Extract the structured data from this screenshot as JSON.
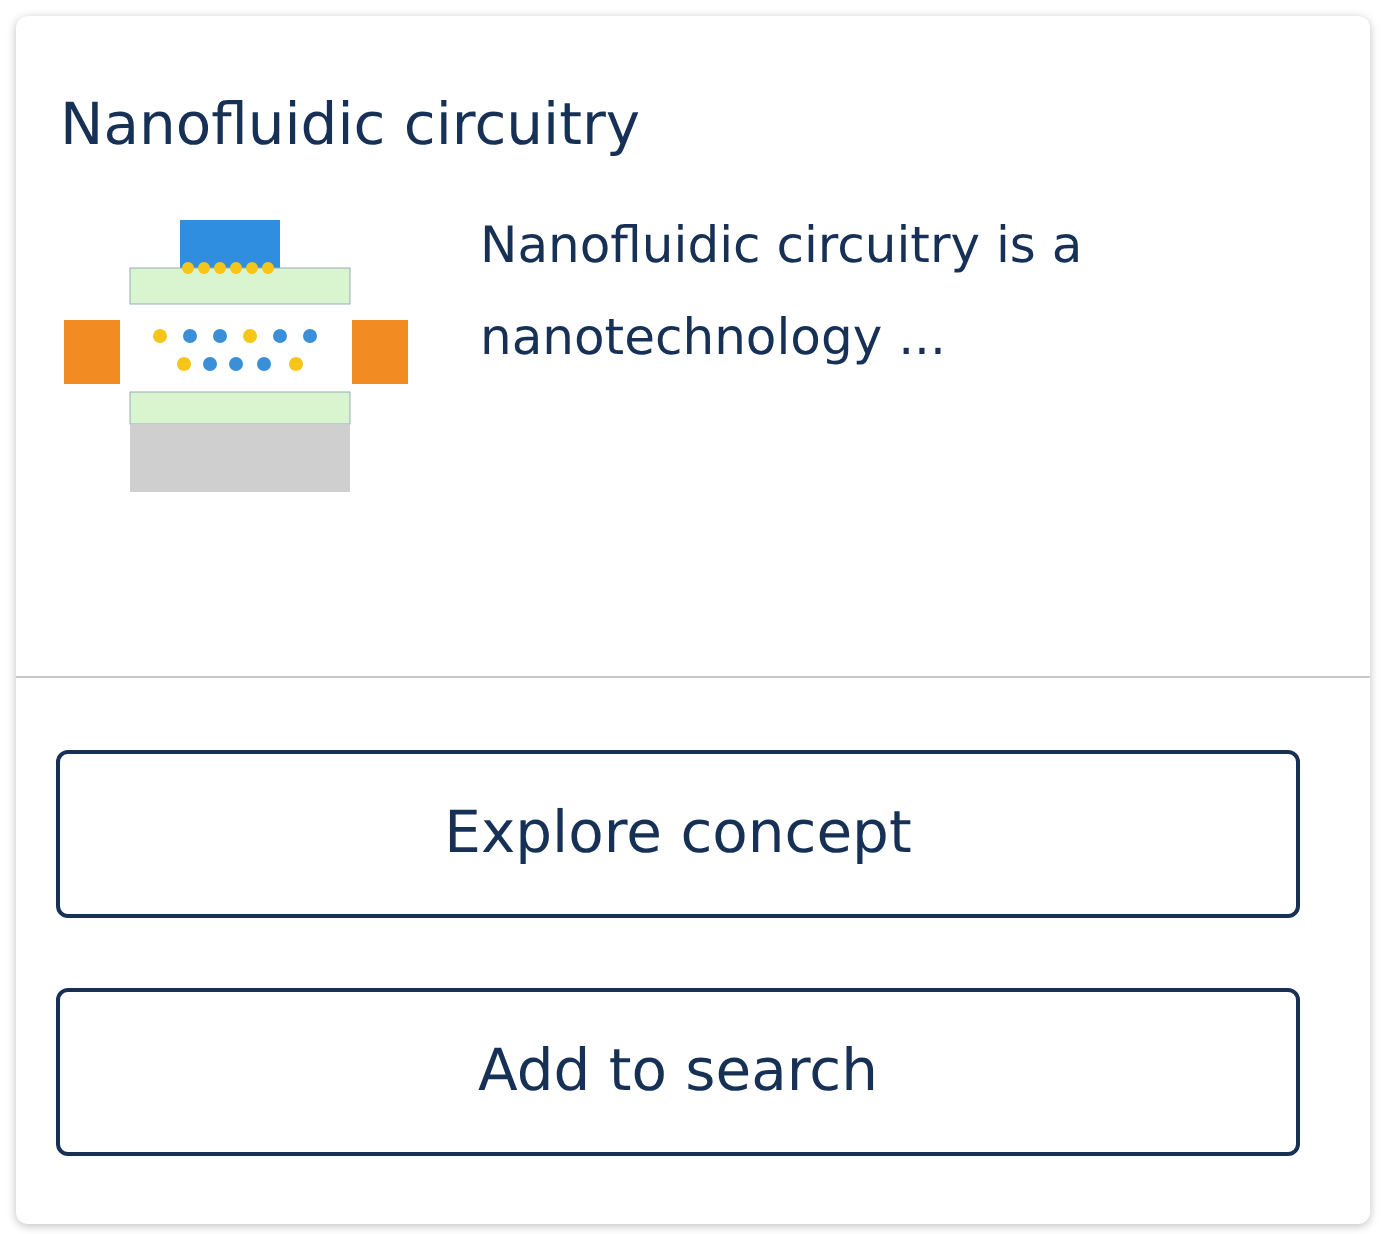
{
  "card": {
    "title": "Nanofluidic circuitry",
    "description": "Nanofluidic circuitry is a nanotechnology ...",
    "buttons": [
      "Explore concept",
      "Add to search"
    ]
  }
}
